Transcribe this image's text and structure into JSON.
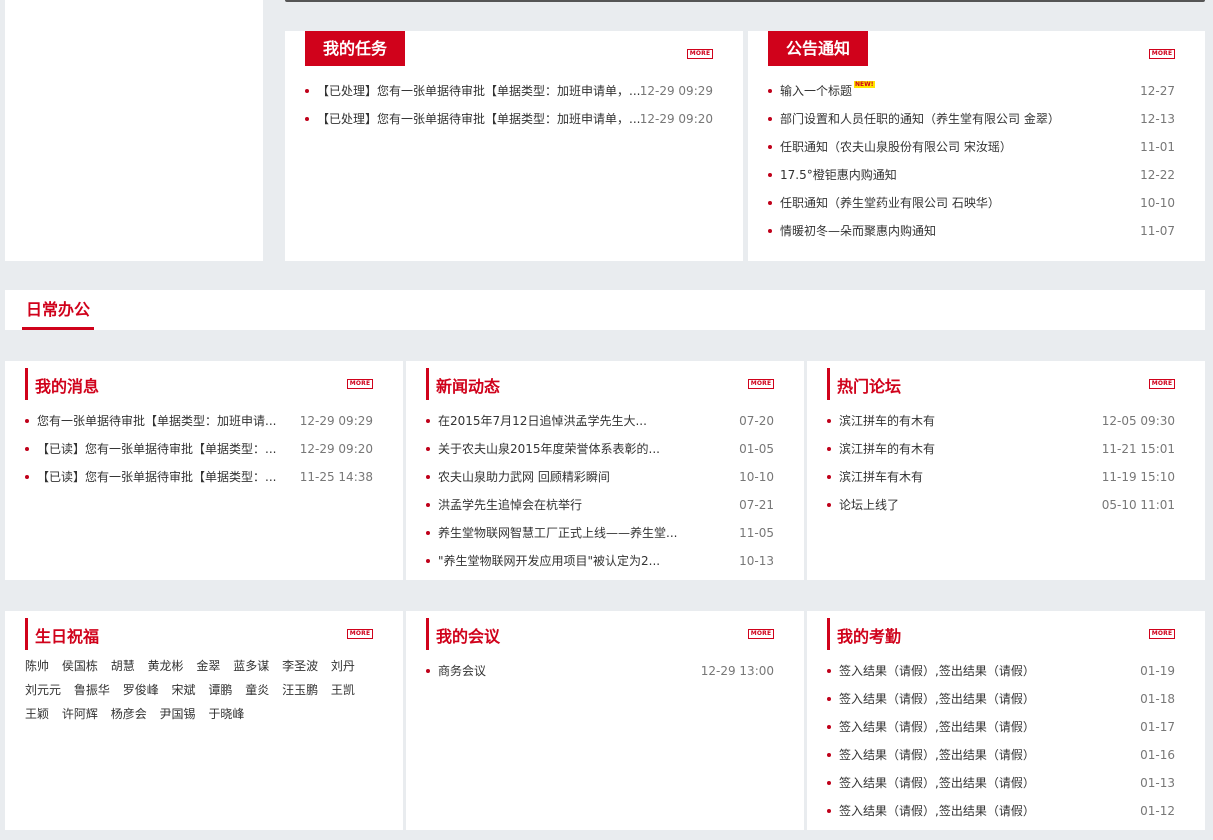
{
  "tasks": {
    "title": "我的任务",
    "more": "MORE",
    "items": [
      {
        "text": "【已处理】您有一张单据待审批【单据类型：加班申请单，...",
        "date": "12-29 09:29"
      },
      {
        "text": "【已处理】您有一张单据待审批【单据类型：加班申请单，...",
        "date": "12-29 09:20"
      }
    ]
  },
  "notices": {
    "title": "公告通知",
    "more": "MORE",
    "new_badge": "NEW!",
    "items": [
      {
        "text": "输入一个标题",
        "date": "12-27"
      },
      {
        "text": "部门设置和人员任职的通知（养生堂有限公司 金翠）",
        "date": "12-13"
      },
      {
        "text": "任职通知（农夫山泉股份有限公司 宋汝瑶）",
        "date": "11-01"
      },
      {
        "text": "17.5°橙钜惠内购通知",
        "date": "12-22"
      },
      {
        "text": "任职通知（养生堂药业有限公司 石映华）",
        "date": "10-10"
      },
      {
        "text": "情暖初冬—朵而聚惠内购通知",
        "date": "11-07"
      }
    ]
  },
  "daily": {
    "title": "日常办公"
  },
  "messages": {
    "title": "我的消息",
    "more": "MORE",
    "items": [
      {
        "text": "您有一张单据待审批【单据类型：加班申请...",
        "date": "12-29 09:29"
      },
      {
        "text": "【已读】您有一张单据待审批【单据类型：...",
        "date": "12-29 09:20"
      },
      {
        "text": "【已读】您有一张单据待审批【单据类型：...",
        "date": "11-25 14:38"
      }
    ]
  },
  "news": {
    "title": "新闻动态",
    "more": "MORE",
    "items": [
      {
        "text": "在2015年7月12日追悼洪孟学先生大...",
        "date": "07-20"
      },
      {
        "text": "关于农夫山泉2015年度荣誉体系表彰的...",
        "date": "01-05"
      },
      {
        "text": "农夫山泉助力武网 回顾精彩瞬间",
        "date": "10-10"
      },
      {
        "text": "洪孟学先生追悼会在杭举行",
        "date": "07-21"
      },
      {
        "text": "养生堂物联网智慧工厂正式上线——养生堂...",
        "date": "11-05"
      },
      {
        "text": "\"养生堂物联网开发应用项目\"被认定为2...",
        "date": "10-13"
      }
    ]
  },
  "forum": {
    "title": "热门论坛",
    "more": "MORE",
    "items": [
      {
        "text": "滨江拼车的有木有",
        "date": "12-05 09:30"
      },
      {
        "text": "滨江拼车的有木有",
        "date": "11-21 15:01"
      },
      {
        "text": "滨江拼车有木有",
        "date": "11-19 15:10"
      },
      {
        "text": "论坛上线了",
        "date": "05-10 11:01"
      }
    ]
  },
  "birthday": {
    "title": "生日祝福",
    "more": "MORE",
    "names": [
      "陈帅",
      "侯国栋",
      "胡慧",
      "黄龙彬",
      "金翠",
      "蓝多谋",
      "李圣波",
      "刘丹",
      "刘元元",
      "鲁振华",
      "罗俊峰",
      "宋斌",
      "谭鹏",
      "童炎",
      "汪玉鹏",
      "王凯",
      "王颖",
      "许阿辉",
      "杨彦会",
      "尹国锡",
      "于晓峰"
    ]
  },
  "meetings": {
    "title": "我的会议",
    "more": "MORE",
    "items": [
      {
        "text": "商务会议",
        "date": "12-29 13:00"
      }
    ]
  },
  "attendance": {
    "title": "我的考勤",
    "more": "MORE",
    "items": [
      {
        "text": "签入结果（请假）,签出结果（请假）",
        "date": "01-19"
      },
      {
        "text": "签入结果（请假）,签出结果（请假）",
        "date": "01-18"
      },
      {
        "text": "签入结果（请假）,签出结果（请假）",
        "date": "01-17"
      },
      {
        "text": "签入结果（请假）,签出结果（请假）",
        "date": "01-16"
      },
      {
        "text": "签入结果（请假）,签出结果（请假）",
        "date": "01-13"
      },
      {
        "text": "签入结果（请假）,签出结果（请假）",
        "date": "01-12"
      }
    ]
  },
  "colors": {
    "accent": "#d0021b",
    "background": "#e9ecef"
  }
}
